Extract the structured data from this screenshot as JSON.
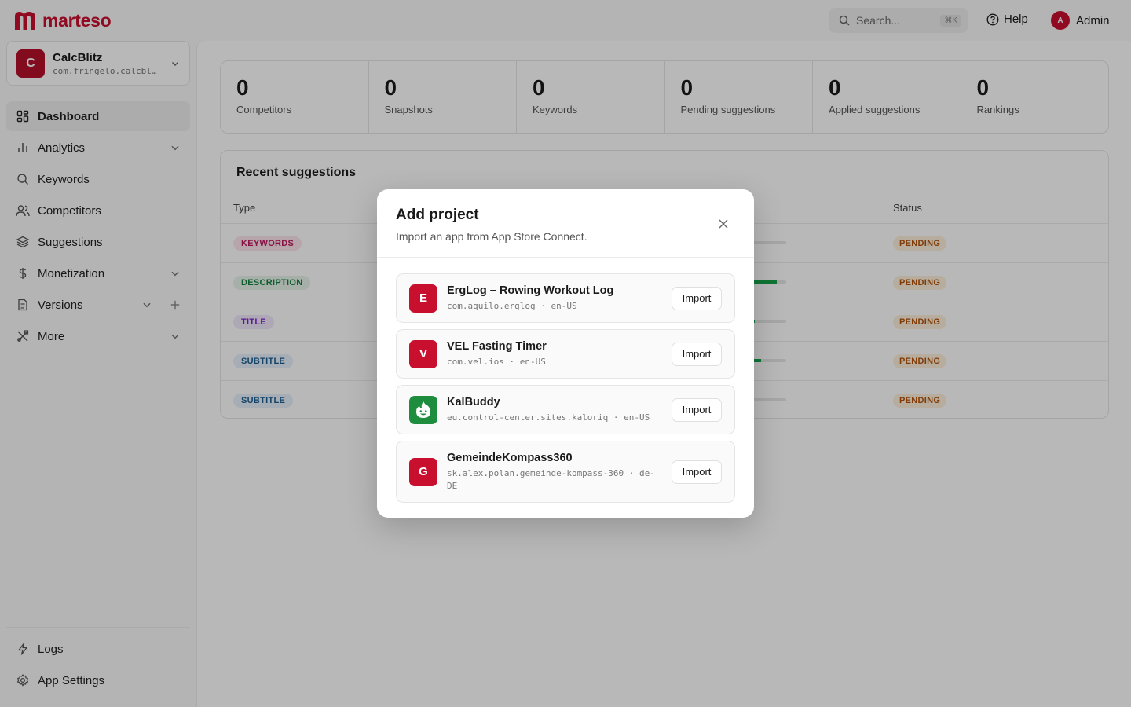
{
  "brand": {
    "name": "marteso",
    "color": "#c8102e"
  },
  "topbar": {
    "search_placeholder": "Search...",
    "search_shortcut": "⌘K",
    "help_label": "Help",
    "user_initial": "A",
    "user_name": "Admin"
  },
  "sidebar": {
    "project": {
      "initial": "C",
      "name": "CalcBlitz",
      "bundle": "com.fringelo.calcbl…"
    },
    "nav": [
      {
        "label": "Dashboard",
        "icon": "dashboard-icon",
        "active": true
      },
      {
        "label": "Analytics",
        "icon": "chart-icon",
        "expandable": true
      },
      {
        "label": "Keywords",
        "icon": "search-icon"
      },
      {
        "label": "Competitors",
        "icon": "users-icon"
      },
      {
        "label": "Suggestions",
        "icon": "layers-icon"
      },
      {
        "label": "Monetization",
        "icon": "dollar-icon",
        "expandable": true
      },
      {
        "label": "Versions",
        "icon": "document-icon",
        "expandable": true,
        "addable": true
      },
      {
        "label": "More",
        "icon": "tools-icon",
        "expandable": true
      }
    ],
    "bottom": [
      {
        "label": "Logs",
        "icon": "bolt-icon"
      },
      {
        "label": "App Settings",
        "icon": "gear-icon"
      }
    ]
  },
  "stats": [
    {
      "value": "0",
      "label": "Competitors"
    },
    {
      "value": "0",
      "label": "Snapshots"
    },
    {
      "value": "0",
      "label": "Keywords"
    },
    {
      "value": "0",
      "label": "Pending suggestions"
    },
    {
      "value": "0",
      "label": "Applied suggestions"
    },
    {
      "value": "0",
      "label": "Rankings"
    }
  ],
  "recent": {
    "title": "Recent suggestions",
    "columns": {
      "type": "Type",
      "status": "Status"
    },
    "rows": [
      {
        "type": "KEYWORDS",
        "type_bg": "#fce7ef",
        "type_fg": "#be185d",
        "score": 0.45,
        "status": "PENDING"
      },
      {
        "type": "DESCRIPTION",
        "type_bg": "#e6f4ea",
        "type_fg": "#15803d",
        "score": 0.85,
        "status": "PENDING"
      },
      {
        "type": "TITLE",
        "type_bg": "#f1e8fb",
        "type_fg": "#7e22ce",
        "score": 0.5,
        "status": "PENDING"
      },
      {
        "type": "SUBTITLE",
        "type_bg": "#e6f0fa",
        "type_fg": "#1d5f91",
        "score": 0.6,
        "status": "PENDING"
      },
      {
        "type": "SUBTITLE",
        "type_bg": "#e6f0fa",
        "type_fg": "#1d5f91",
        "score": 0.45,
        "status": "PENDING"
      }
    ]
  },
  "modal": {
    "title": "Add project",
    "subtitle": "Import an app from App Store Connect.",
    "import_label": "Import",
    "apps": [
      {
        "initial": "E",
        "name": "ErgLog – Rowing Workout Log",
        "meta": "com.aquilo.erglog · en-US",
        "icon_bg": "#c8102e"
      },
      {
        "initial": "V",
        "name": "VEL Fasting Timer",
        "meta": "com.vel.ios · en-US",
        "icon_bg": "#c8102e"
      },
      {
        "initial": "",
        "name": "KalBuddy",
        "meta": "eu.control-center.sites.kaloriq · en-US",
        "icon_bg": "#1e8e3e",
        "icon": "flame-face-icon"
      },
      {
        "initial": "G",
        "name": "GemeindeKompass360",
        "meta": "sk.alex.polan.gemeinde-kompass-360 · de-DE",
        "icon_bg": "#c8102e"
      }
    ]
  }
}
